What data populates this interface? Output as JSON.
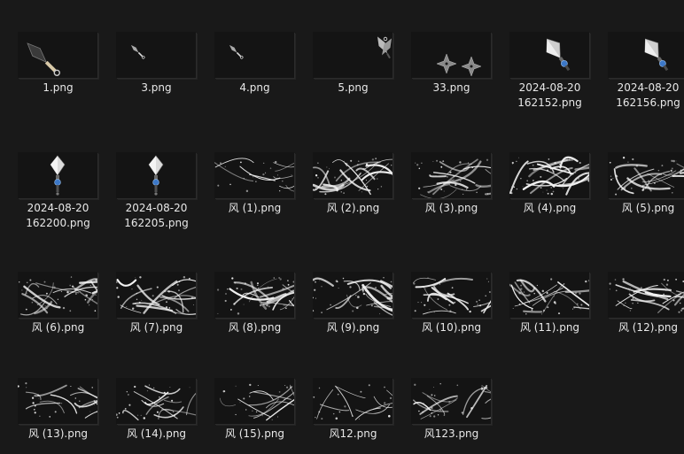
{
  "files": [
    {
      "name": "1.png",
      "icon": "kunai-icon"
    },
    {
      "name": "3.png",
      "icon": "small-kunai-icon"
    },
    {
      "name": "4.png",
      "icon": "small-kunai-icon"
    },
    {
      "name": "5.png",
      "icon": "kunai-pair-icon"
    },
    {
      "name": "33.png",
      "icon": "shuriken-icon"
    },
    {
      "name": "2024-08-20\n162152.png",
      "icon": "blue-gem-kunai-icon"
    },
    {
      "name": "2024-08-20\n162156.png",
      "icon": "blue-gem-kunai-icon"
    },
    {
      "name": "2024-08-20\n162200.png",
      "icon": "upright-kunai-icon"
    },
    {
      "name": "2024-08-20\n162205.png",
      "icon": "upright-kunai-icon"
    },
    {
      "name": "风 (1).png",
      "icon": "wind-effect-icon"
    },
    {
      "name": "风 (2).png",
      "icon": "wind-effect-icon"
    },
    {
      "name": "风 (3).png",
      "icon": "wind-effect-icon"
    },
    {
      "name": "风 (4).png",
      "icon": "wind-effect-icon"
    },
    {
      "name": "风 (5).png",
      "icon": "wind-effect-icon"
    },
    {
      "name": "风 (6).png",
      "icon": "wind-effect-icon"
    },
    {
      "name": "风 (7).png",
      "icon": "wind-effect-icon"
    },
    {
      "name": "风 (8).png",
      "icon": "wind-effect-icon"
    },
    {
      "name": "风 (9).png",
      "icon": "wind-effect-icon"
    },
    {
      "name": "风 (10).png",
      "icon": "wind-effect-icon"
    },
    {
      "name": "风 (11).png",
      "icon": "wind-effect-icon"
    },
    {
      "name": "风 (12).png",
      "icon": "wind-effect-icon"
    },
    {
      "name": "风 (13).png",
      "icon": "wind-effect-icon"
    },
    {
      "name": "风 (14).png",
      "icon": "wind-effect-icon"
    },
    {
      "name": "风 (15).png",
      "icon": "wind-effect-icon"
    },
    {
      "name": "风12.png",
      "icon": "wind-effect-icon"
    },
    {
      "name": "风123.png",
      "icon": "wind-effect-icon"
    }
  ]
}
